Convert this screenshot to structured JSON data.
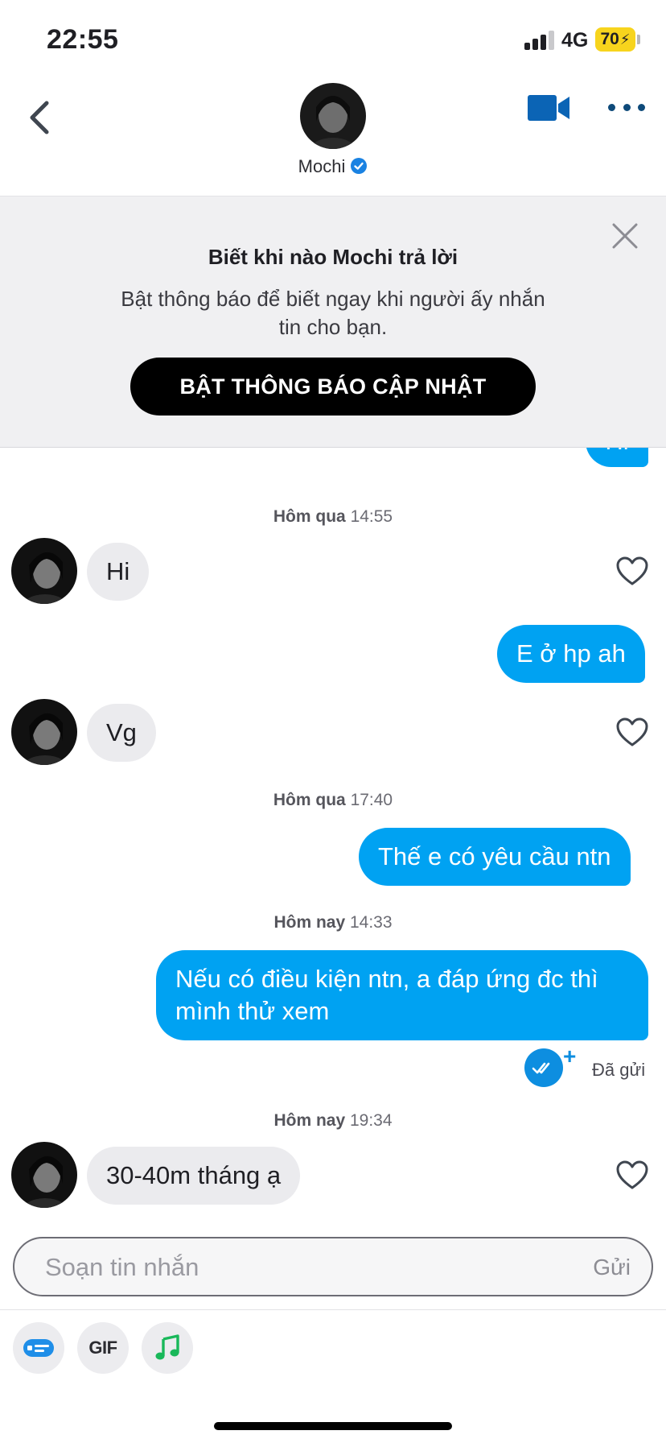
{
  "status_bar": {
    "time": "22:55",
    "network": "4G",
    "battery": "70"
  },
  "header": {
    "contact_name": "Mochi",
    "verified": true,
    "icons": [
      "back-icon",
      "video-call-icon",
      "more-icon",
      "verified-badge-icon"
    ]
  },
  "notification_banner": {
    "title": "Biết khi nào Mochi trả lời",
    "description": "Bật thông báo để biết ngay khi người ấy nhắn tin cho bạn.",
    "button_label": "BẬT THÔNG BÁO CẬP NHẬT"
  },
  "messages": {
    "partial_top": "Hi",
    "group1": {
      "day": "Hôm qua",
      "time": "14:55"
    },
    "in1": "Hi",
    "out1": "E ở hp ah",
    "in2": "Vg",
    "group2": {
      "day": "Hôm qua",
      "time": "17:40"
    },
    "out2": "Thế e có yêu cầu ntn",
    "group3": {
      "day": "Hôm nay",
      "time": "14:33"
    },
    "out3": "Nếu có điều kiện ntn, a đáp ứng đc thì mình thử xem",
    "sent_status": "Đã gửi",
    "group4": {
      "day": "Hôm nay",
      "time": "19:34"
    },
    "in3": "30-40m tháng ạ"
  },
  "composer": {
    "placeholder": "Soạn tin nhắn",
    "send_label": "Gửi"
  },
  "tools": {
    "gif_label": "GIF",
    "icons": [
      "sticker-card-icon",
      "gif-icon",
      "music-note-icon"
    ]
  },
  "colors": {
    "outgoing_bubble": "#00a2f2",
    "incoming_bubble": "#ebebee",
    "battery": "#f7d41d",
    "video_icon": "#0b64b5"
  }
}
